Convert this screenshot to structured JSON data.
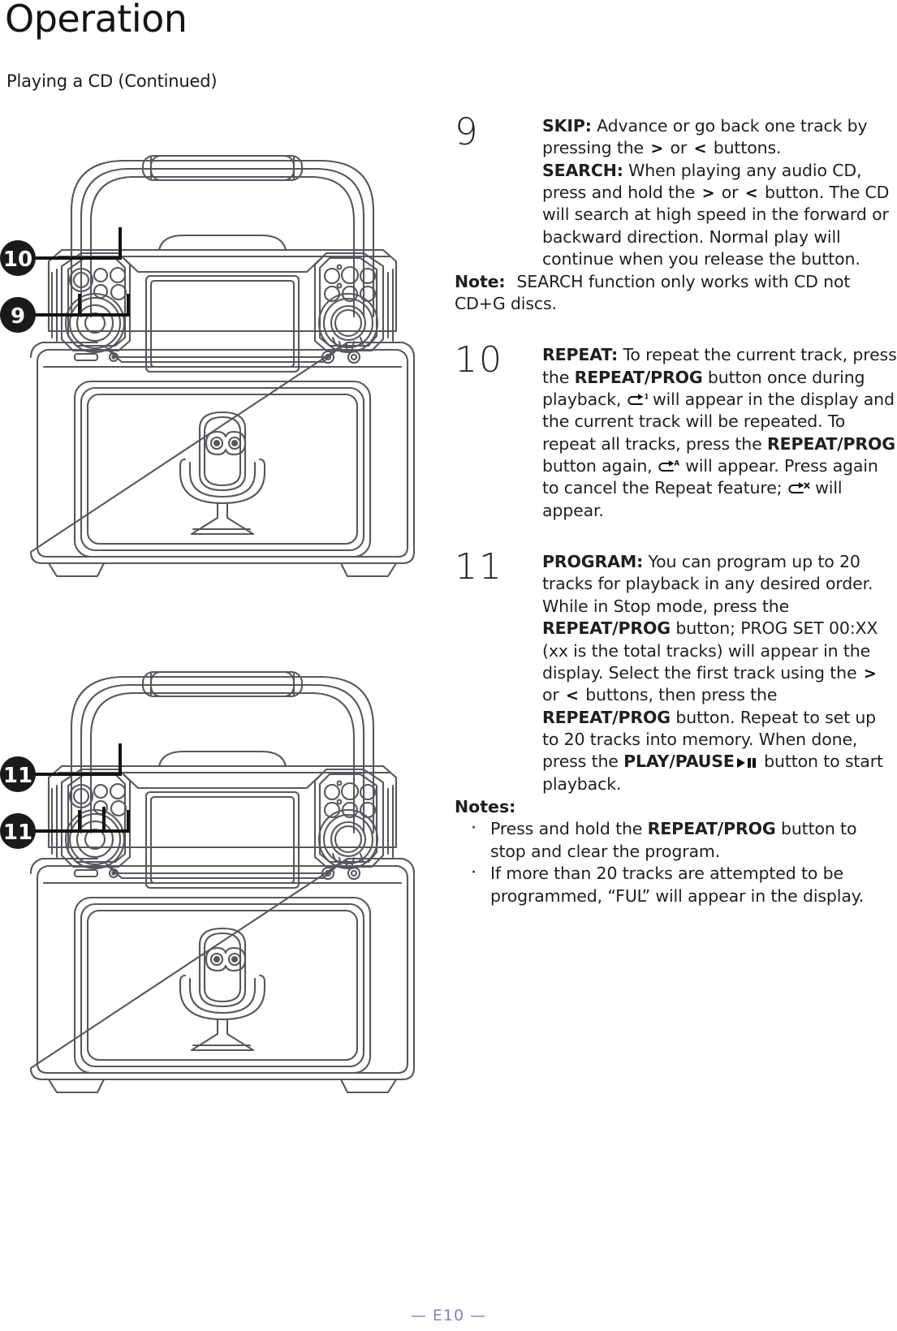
{
  "header": {
    "title": "Operation",
    "subtitle": "Playing a CD (Continued)"
  },
  "steps": [
    {
      "number": "9",
      "label_skip": "SKIP:",
      "text_skip_a": " Advance or go back one track by pressing the ",
      "glyph_fwd": ">",
      "text_skip_b": " or ",
      "glyph_bwd": "<",
      "text_skip_c": " buttons.",
      "label_search": "SEARCH:",
      "text_search_a": " When playing any audio CD, press and hold the ",
      "text_search_b": " or ",
      "text_search_c": " button. The CD will search at high speed in the forward or backward direction. Normal play will continue when you release the button."
    }
  ],
  "note9": {
    "label": "Note:",
    "text": "SEARCH function only works with CD not CD+G discs."
  },
  "step10": {
    "number": "10",
    "label_repeat": "REPEAT:",
    "t1": " To repeat the current track, press the ",
    "b1": "REPEAT/PROG",
    "t2": " button once during playback, ",
    "icon1": "repeat-one-icon",
    "t3": " will appear in the display and the current track will be repeated. To repeat all tracks, press the ",
    "b2": "REPEAT/PROG",
    "t4": " button again, ",
    "icon2": "repeat-all-icon",
    "t5": " will appear. Press again to cancel the Repeat feature; ",
    "icon3": "repeat-off-icon",
    "t6": " will appear."
  },
  "step11": {
    "number": "11",
    "label_program": "PROGRAM:",
    "t1": " You can program up to 20 tracks for playback in any desired order. While in Stop mode, press the ",
    "b1": "REPEAT/PROG",
    "t2": " button; PROG SET 00:XX (xx is the total tracks) will appear in the display. Select the first track using the ",
    "glyph_fwd": ">",
    "t3": " or ",
    "glyph_bwd": "<",
    "t4": " buttons, then press the ",
    "b2": "REPEAT/PROG",
    "t5": " button. Repeat to set up to 20 tracks into memory. When done, press the ",
    "b3": "PLAY/PAUSE",
    "icon_playpause": "play-pause-icon",
    "t6": " button to start playback."
  },
  "notes": {
    "heading": "Notes:",
    "items": [
      {
        "pre": "Press and hold the ",
        "bold": "REPEAT/PROG",
        "post": " button to stop and clear the program."
      },
      {
        "pre": "If more than 20 tracks are attempted to be programmed, “FUL” will appear in the display.",
        "bold": "",
        "post": ""
      }
    ]
  },
  "illustrations": [
    {
      "name": "karaoke-machine-top-view-1",
      "callouts": [
        {
          "label": "10",
          "target": "repeat-prog-button"
        },
        {
          "label": "9",
          "target": "skip-search-buttons"
        }
      ]
    },
    {
      "name": "karaoke-machine-top-view-2",
      "callouts": [
        {
          "label": "11",
          "target": "repeat-prog-button"
        },
        {
          "label": "11",
          "target": "skip-search-buttons"
        }
      ]
    }
  ],
  "footer": {
    "page_marker": "— E10 —"
  },
  "colors": {
    "text": "#1f1f1f",
    "line_art": "#57575d",
    "callout_fill": "#1a1a1a",
    "footer": "#8183bb"
  }
}
